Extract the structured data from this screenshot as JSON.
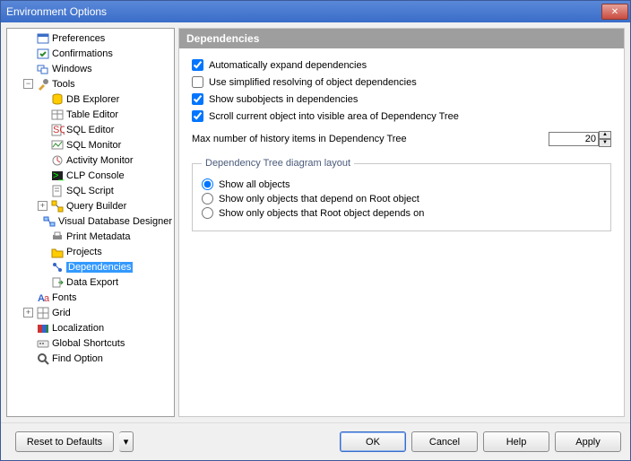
{
  "window": {
    "title": "Environment Options"
  },
  "tree": {
    "items": [
      {
        "label": "Preferences",
        "indent": 1,
        "icon": "pref",
        "toggle": ""
      },
      {
        "label": "Confirmations",
        "indent": 1,
        "icon": "confirm",
        "toggle": ""
      },
      {
        "label": "Windows",
        "indent": 1,
        "icon": "windows",
        "toggle": ""
      },
      {
        "label": "Tools",
        "indent": 1,
        "icon": "tools",
        "toggle": "−"
      },
      {
        "label": "DB Explorer",
        "indent": 2,
        "icon": "db",
        "toggle": ""
      },
      {
        "label": "Table Editor",
        "indent": 2,
        "icon": "table",
        "toggle": ""
      },
      {
        "label": "SQL Editor",
        "indent": 2,
        "icon": "sqled",
        "toggle": ""
      },
      {
        "label": "SQL Monitor",
        "indent": 2,
        "icon": "sqlmon",
        "toggle": ""
      },
      {
        "label": "Activity Monitor",
        "indent": 2,
        "icon": "activity",
        "toggle": ""
      },
      {
        "label": "CLP Console",
        "indent": 2,
        "icon": "clp",
        "toggle": ""
      },
      {
        "label": "SQL Script",
        "indent": 2,
        "icon": "sqlscr",
        "toggle": ""
      },
      {
        "label": "Query Builder",
        "indent": 2,
        "icon": "qb",
        "toggle": "+"
      },
      {
        "label": "Visual Database Designer",
        "indent": 2,
        "icon": "vdd",
        "toggle": ""
      },
      {
        "label": "Print Metadata",
        "indent": 2,
        "icon": "print",
        "toggle": ""
      },
      {
        "label": "Projects",
        "indent": 2,
        "icon": "proj",
        "toggle": ""
      },
      {
        "label": "Dependencies",
        "indent": 2,
        "icon": "dep",
        "toggle": "",
        "selected": true
      },
      {
        "label": "Data Export",
        "indent": 2,
        "icon": "export",
        "toggle": ""
      },
      {
        "label": "Fonts",
        "indent": 1,
        "icon": "fonts",
        "toggle": ""
      },
      {
        "label": "Grid",
        "indent": 1,
        "icon": "grid",
        "toggle": "+"
      },
      {
        "label": "Localization",
        "indent": 1,
        "icon": "loc",
        "toggle": ""
      },
      {
        "label": "Global Shortcuts",
        "indent": 1,
        "icon": "short",
        "toggle": ""
      },
      {
        "label": "Find Option",
        "indent": 1,
        "icon": "find",
        "toggle": ""
      }
    ]
  },
  "panel": {
    "header": "Dependencies",
    "chk_auto_expand": "Automatically expand dependencies",
    "chk_simplified": "Use simplified resolving of object dependencies",
    "chk_subobjects": "Show subobjects in dependencies",
    "chk_scroll": "Scroll current object into visible area of Dependency Tree",
    "max_history_label": "Max number of history items in Dependency Tree",
    "max_history_value": "20",
    "group_legend": "Dependency Tree diagram layout",
    "radio_all": "Show all objects",
    "radio_depend": "Show only objects that depend on Root object",
    "radio_root": "Show only objects that Root object depends on"
  },
  "footer": {
    "reset": "Reset to Defaults",
    "ok": "OK",
    "cancel": "Cancel",
    "help": "Help",
    "apply": "Apply"
  }
}
